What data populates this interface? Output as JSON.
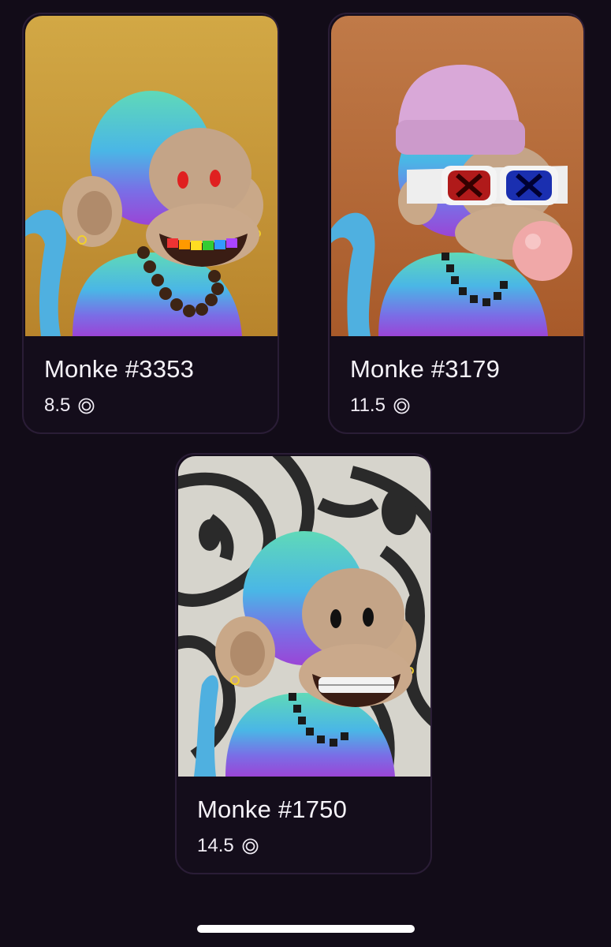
{
  "items": [
    {
      "name": "Monke #3353",
      "price": "8.5",
      "currency_icon": "coin-icon",
      "background": "#c9993a"
    },
    {
      "name": "Monke #3179",
      "price": "11.5",
      "currency_icon": "coin-icon",
      "background": "#b8693a"
    },
    {
      "name": "Monke #1750",
      "price": "14.5",
      "currency_icon": "coin-icon",
      "background": "#d8d6cf"
    }
  ]
}
